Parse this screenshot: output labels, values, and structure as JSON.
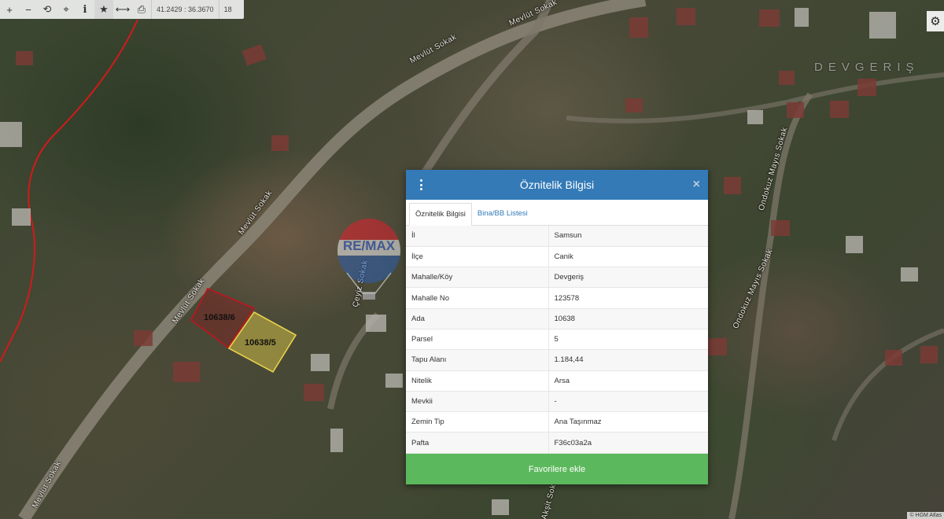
{
  "toolbar": {
    "zoom_in": "+",
    "zoom_out": "−",
    "refresh": "⟲",
    "locate": "⌖",
    "info": "i",
    "favorite": "★",
    "measure": "⟷",
    "print": "⎙",
    "coordinates": "41.2429 : 36.3670",
    "zoom_level": "18"
  },
  "map": {
    "area_name": "DEVGERIŞ",
    "roads": [
      "Mevlüt Sokak",
      "Mevlüt Sokak",
      "Mevlüt Sokak",
      "Mevlüt Sokak",
      "Mevlüt Sokak",
      "Ondokuz Mayıs Sokak",
      "Ondokuz Mayıs Sokak",
      "Çeyiz Sokak",
      "Akşit Sokak"
    ],
    "parcels": [
      "10638/6",
      "10638/5"
    ],
    "attribution": "© HGM Atlas"
  },
  "watermark": {
    "balloon_text": "RE/MAX",
    "text_left": "RE",
    "text_slash": "/",
    "text_right": "MAX",
    "registered": "®"
  },
  "popup": {
    "title": "Öznitelik Bilgisi",
    "close": "×",
    "tabs": [
      "Öznitelik Bilgisi",
      "Bina/BB Listesi"
    ],
    "rows": [
      {
        "key": "İl",
        "value": "Samsun"
      },
      {
        "key": "İlçe",
        "value": "Canik"
      },
      {
        "key": "Mahalle/Köy",
        "value": "Devgeriş"
      },
      {
        "key": "Mahalle No",
        "value": "123578"
      },
      {
        "key": "Ada",
        "value": "10638"
      },
      {
        "key": "Parsel",
        "value": "5"
      },
      {
        "key": "Tapu Alanı",
        "value": "1.184,44"
      },
      {
        "key": "Nitelik",
        "value": "Arsa"
      },
      {
        "key": "Mevkii",
        "value": "-"
      },
      {
        "key": "Zemin Tip",
        "value": "Ana Taşınmaz"
      },
      {
        "key": "Pafta",
        "value": "F36c03a2a"
      }
    ],
    "favorite_button": "Favorilere ekle"
  },
  "colors": {
    "header_blue": "#337ab7",
    "button_green": "#5cb85c",
    "parcel_selected": "#e8d24a",
    "parcel_other": "#c0141e",
    "boundary_red": "#d21a1a"
  }
}
